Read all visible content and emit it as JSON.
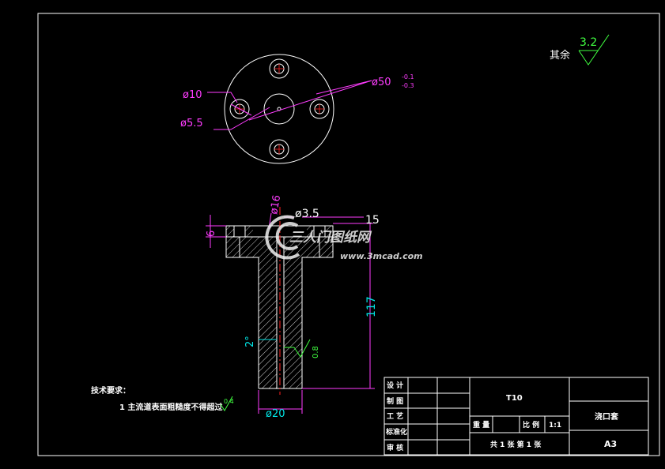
{
  "colors": {
    "background": "#000000",
    "outline": "#ffffff",
    "dimension_magenta": "#ff3cff",
    "dimension_cyan": "#00e5e5",
    "surface_green": "#40ff40",
    "center_red": "#ff2020"
  },
  "top_view": {
    "dim_hole_large": "ø10",
    "dim_hole_small": "ø5.5",
    "dim_outer": "ø50",
    "dim_outer_tol_upper": "-0.1",
    "dim_outer_tol_lower": "-0.3"
  },
  "section_view": {
    "dim_flange_height": "6",
    "dim_bore_top": "ø16",
    "dim_bore_small": "ø3.5",
    "dim_flange_step": "15",
    "dim_total_height": "117",
    "dim_taper_angle": "2°",
    "dim_shaft_diameter": "ø20",
    "roughness_inner": "0.8"
  },
  "roughness_note": {
    "label": "其余",
    "value": "3.2"
  },
  "tech_requirements": {
    "title": "技术要求：",
    "item1": "1  主流道表面粗糙度不得超过",
    "item1_value": "0.4"
  },
  "watermark": {
    "brand": "三人门图纸网",
    "url": "www.3mcad.com"
  },
  "title_block": {
    "row_design": "设 计",
    "row_draw": "制 图",
    "row_process": "工 艺",
    "row_standard": "标准化",
    "row_review": "审 核",
    "material": "T10",
    "weight_label": "重 量",
    "scale_label": "比 例",
    "scale_value": "1:1",
    "sheets": "共 1 张   第 1 张",
    "part_name": "浇口套",
    "sheet_size": "A3"
  }
}
